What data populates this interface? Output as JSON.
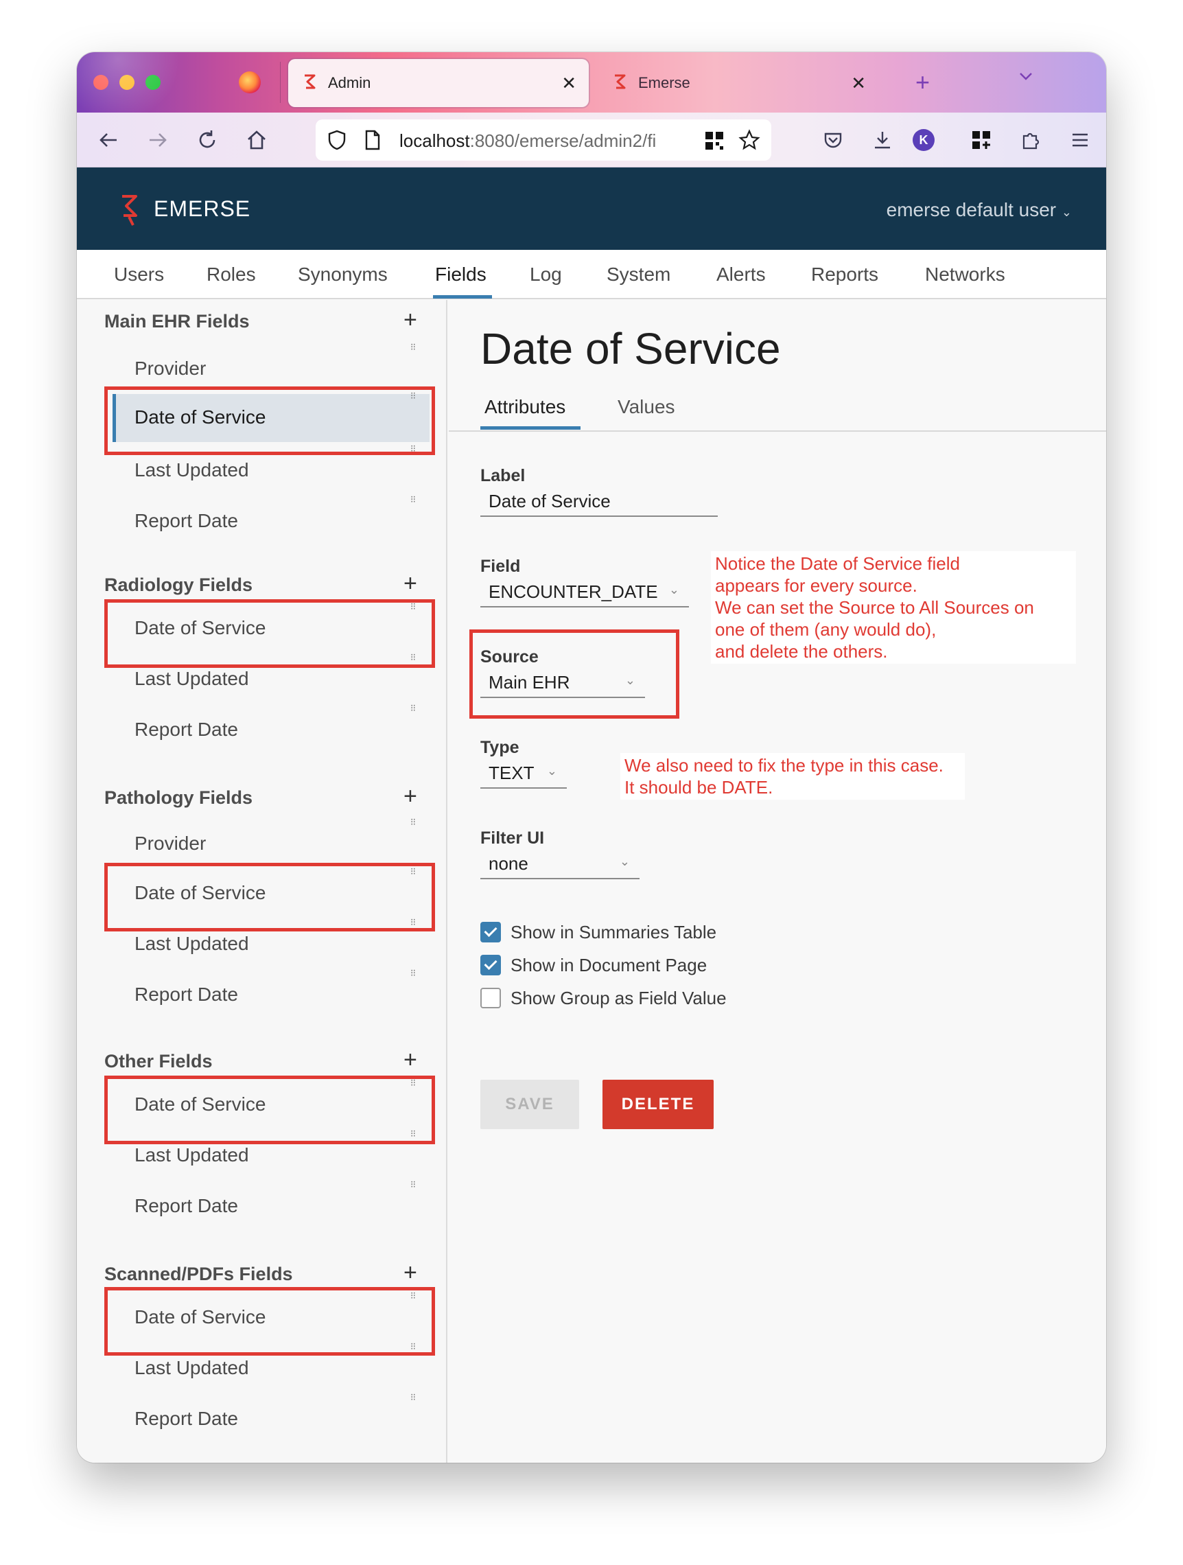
{
  "browser": {
    "tabs": [
      {
        "label": "Admin",
        "active": true
      },
      {
        "label": "Emerse",
        "active": false
      }
    ],
    "url_host": "localhost",
    "url_path": ":8080/emerse/admin2/fi",
    "account_initial": "K"
  },
  "app": {
    "brand": "EMERSE",
    "user_menu": "emerse default user"
  },
  "admin_tabs": [
    "Users",
    "Roles",
    "Synonyms",
    "Fields",
    "Log",
    "System",
    "Alerts",
    "Reports",
    "Networks"
  ],
  "selected_admin_tab": "Fields",
  "sidebar": {
    "sections": [
      {
        "title": "Main EHR Fields",
        "items": [
          "Provider",
          "Date of Service",
          "Last Updated",
          "Report Date"
        ]
      },
      {
        "title": "Radiology Fields",
        "items": [
          "Date of Service",
          "Last Updated",
          "Report Date"
        ]
      },
      {
        "title": "Pathology Fields",
        "items": [
          "Provider",
          "Date of Service",
          "Last Updated",
          "Report Date"
        ]
      },
      {
        "title": "Other Fields",
        "items": [
          "Date of Service",
          "Last Updated",
          "Report Date"
        ]
      },
      {
        "title": "Scanned/PDFs Fields",
        "items": [
          "Date of Service",
          "Last Updated",
          "Report Date"
        ]
      }
    ]
  },
  "detail": {
    "title": "Date of Service",
    "subtabs": [
      "Attributes",
      "Values"
    ],
    "label": {
      "caption": "Label",
      "value": "Date of Service"
    },
    "field": {
      "caption": "Field",
      "value": "ENCOUNTER_DATE"
    },
    "source": {
      "caption": "Source",
      "value": "Main EHR"
    },
    "type": {
      "caption": "Type",
      "value": "TEXT"
    },
    "filter_ui": {
      "caption": "Filter UI",
      "value": "none"
    },
    "checkboxes": [
      {
        "label": "Show in Summaries Table",
        "checked": true
      },
      {
        "label": "Show in Document Page",
        "checked": true
      },
      {
        "label": "Show Group as Field Value",
        "checked": false
      }
    ],
    "save_label": "SAVE",
    "delete_label": "DELETE"
  },
  "annotations": {
    "note1": [
      "Notice the Date of Service field",
      "appears for every source.",
      "We can set the Source to All Sources on",
      "one of them (any would do),",
      "and delete the others."
    ],
    "note2": [
      "We also need to fix the type in this case.",
      "It should be DATE."
    ]
  },
  "colors": {
    "header_bg": "#14364d",
    "accent": "#3a7eb0",
    "highlight_box": "#e03a33",
    "delete_button": "#d33a2c"
  }
}
